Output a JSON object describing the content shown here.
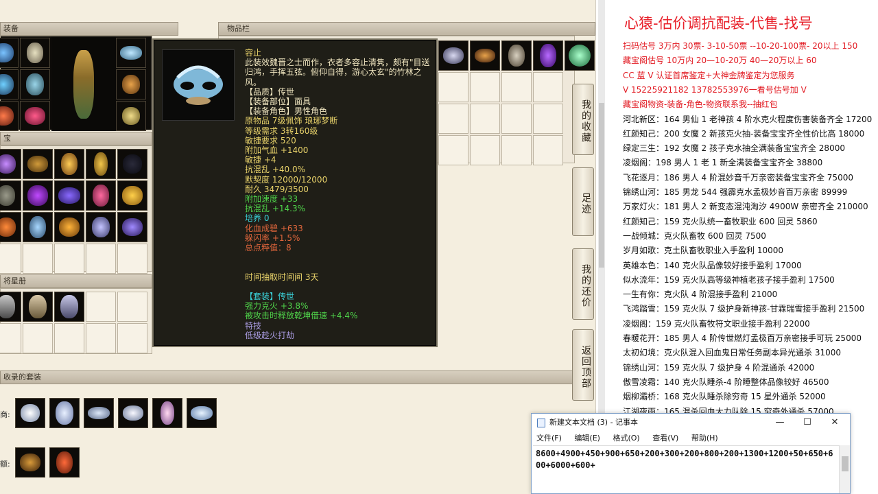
{
  "game": {
    "equip_header": "装备",
    "bag_header": "物品栏",
    "treasure_header": "宝",
    "star_header": "将星册",
    "suit_header": "收录的套装",
    "suit_row1_label": "商:",
    "suit_row2_label": "额:"
  },
  "tooltip": {
    "name": "容止",
    "lines": [
      {
        "text": "此装效魏晋之士而作，衣者多容止清隽，颇有\"目送",
        "color": "#f0e6c0"
      },
      {
        "text": "归鸿，手挥五弦。俯仰自得，游心太玄\"的竹林之",
        "color": "#f0e6c0"
      },
      {
        "text": "风。",
        "color": "#f0e6c0"
      },
      {
        "text": "【品质】传世",
        "color": "#f0e6c0"
      },
      {
        "text": "【装备部位】面具",
        "color": "#f0e6c0"
      },
      {
        "text": "【装备角色】男性角色",
        "color": "#f0e6c0"
      },
      {
        "text": "原物品 7级佩饰 琅琊梦断",
        "color": "#e8d26a"
      },
      {
        "text": "等级需求 3转160级",
        "color": "#e8d26a"
      },
      {
        "text": "敏捷要求 520",
        "color": "#e8d26a"
      },
      {
        "text": "附加气血 +1400",
        "color": "#e8d26a"
      },
      {
        "text": "敏捷 +4",
        "color": "#e8d26a"
      },
      {
        "text": "抗混乱 +40.0%",
        "color": "#e8d26a"
      },
      {
        "text": "默契度 12000/12000",
        "color": "#e8d26a"
      },
      {
        "text": "耐久 3479/3500",
        "color": "#e8d26a"
      },
      {
        "text": "附加速度 +33",
        "color": "#4fd34a"
      },
      {
        "text": "抗混乱 +14.3%",
        "color": "#4fd34a"
      },
      {
        "text": "培养 0",
        "color": "#3ad0d8"
      },
      {
        "text": "化血成碧 +633",
        "color": "#e0663c"
      },
      {
        "text": "躲闪率 +1.5%",
        "color": "#e0663c"
      },
      {
        "text": "总点粹值：8",
        "color": "#e0663c"
      },
      {
        "text": "",
        "color": "#f0e6c0"
      },
      {
        "text": "",
        "color": "#f0e6c0"
      },
      {
        "text": "时间抽取时间间  3天",
        "color": "#e8d26a"
      },
      {
        "text": "",
        "color": "#f0e6c0"
      },
      {
        "text": "【套装】传世",
        "color": "#3ad0d8"
      },
      {
        "text": "强力克火 +3.8%",
        "color": "#4fd34a"
      },
      {
        "text": "被攻击时释放乾坤借速 +4.4%",
        "color": "#4fd34a"
      },
      {
        "text": "特技",
        "color": "#a99be0"
      },
      {
        "text": "低级趁火打劫",
        "color": "#a99be0"
      }
    ]
  },
  "side_buttons": [
    "我的收藏",
    "足迹",
    "我的还价",
    "返回顶部"
  ],
  "doc": {
    "title": "心猿-估价调抗配装-代售-找号",
    "lines": [
      {
        "text": "扫码估号 3万内 30票- 3-10-50票 --10-20-100票- 20以上 150",
        "cls": "red"
      },
      {
        "text": "藏宝阁估号 10万内 20—10-20万 40—20万以上 60",
        "cls": "red"
      },
      {
        "text": "CC 蓝 V 认证首席鉴定+大神金牌鉴定为您服务",
        "cls": "red"
      },
      {
        "text": "V 15225921182     13782553976一看号估号加 V",
        "cls": "red"
      },
      {
        "text": "藏宝阁物资-装备-角色-物资联系我--抽红包",
        "cls": "red"
      },
      {
        "text": "河北新区：164 男仙 1 老神孩 4 阶水克火程度伤害装备齐全 17200",
        "cls": "blk"
      },
      {
        "text": "红颜知己：200 女魔 2 新孩克火抽-装备宝宝齐全性价比高 18000",
        "cls": "blk"
      },
      {
        "text": "绿定三生：192 女魔 2 孩子克水抽全满装备宝宝齐全 28000",
        "cls": "blk"
      },
      {
        "text": "凌烟阁：198 男人 1 老 1 新全满装备宝宝齐全 38800",
        "cls": "blk"
      },
      {
        "text": "飞花逐月：186 男人 4 阶混妙音千万亲密装备宝宝齐全 75000",
        "cls": "blk"
      },
      {
        "text": "锦绣山河：185 男龙 544 强霹克水孟极妙音百万亲密 89999",
        "cls": "blk"
      },
      {
        "text": "万家灯火：181 男人 2 新变态混沌淘汐 4900W 亲密齐全 210000",
        "cls": "blk"
      },
      {
        "text": "红颜知己：159 克火队统一畜牧职业 600 回灵 5860",
        "cls": "blk"
      },
      {
        "text": "一战倾城：克火队畜牧 600 回灵 7500",
        "cls": "blk"
      },
      {
        "text": "岁月如歌：克土队畜牧职业入手盈利 10000",
        "cls": "blk"
      },
      {
        "text": "英雄本色：140 克火队品像较好接手盈利 17000",
        "cls": "blk"
      },
      {
        "text": "似水流年：159 克火队高等级神植老孩子接手盈利 17500",
        "cls": "blk"
      },
      {
        "text": "一生有你：克火队 4 阶混接手盈利 21000",
        "cls": "blk"
      },
      {
        "text": "飞鸿踏雪：159 克火队 7 级护身新神孩-甘霖瑞雪接手盈利 21500",
        "cls": "blk"
      },
      {
        "text": "凌烟阁：159 克火队畜牧符文职业接手盈利 22000",
        "cls": "blk"
      },
      {
        "text": "春暖花开：185 男人 4 阶传世燃灯孟极百万亲密接手可玩 25000",
        "cls": "blk"
      },
      {
        "text": "太初幻境：克火队混入回血鬼日常任务副本异光通杀 31000",
        "cls": "blk"
      },
      {
        "text": "锦绣山河：159 克火队 7 级护身 4 阶混通杀 42000",
        "cls": "blk"
      },
      {
        "text": "傲雪凌霜：140 克火队睡杀-4 阶睡整体品像较好 46500",
        "cls": "blk"
      },
      {
        "text": "烟柳灞桥：168 克火队睡杀除穷奇 15 星外通杀 52000",
        "cls": "blk"
      },
      {
        "text": "江湖夜雨：165 混杀回血大力队除 15 穷奇外通杀 57000",
        "cls": "blk"
      }
    ]
  },
  "notepad": {
    "title": "新建文本文档 (3) - 记事本",
    "menu": [
      "文件(F)",
      "编辑(E)",
      "格式(O)",
      "查看(V)",
      "帮助(H)"
    ],
    "minimize": "—",
    "maximize": "☐",
    "close": "✕",
    "content": "8600+4900+450+900+650+200+300+200+800+200+1300+1200+50+650+600+6000+600+"
  }
}
